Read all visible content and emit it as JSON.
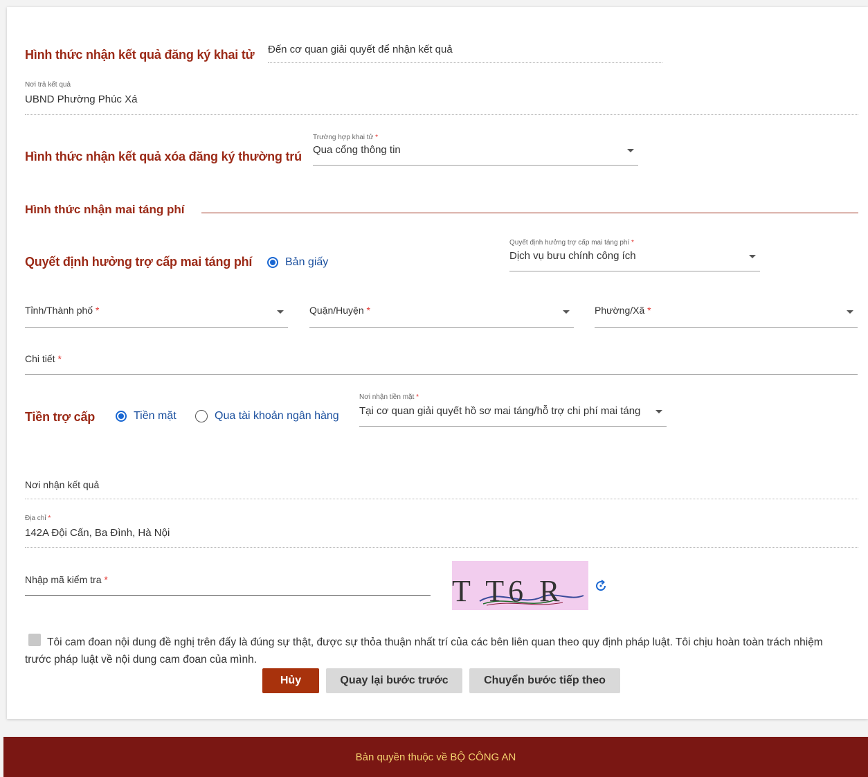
{
  "sections": {
    "death_result": {
      "title": "Hình thức nhận kết quả đăng ký khai tử",
      "value": "Đến cơ quan giải quyết để nhận kết quả"
    },
    "return_place": {
      "label": "Nơi trả kết quả",
      "value": "UBND Phường Phúc Xá"
    },
    "residence_removal": {
      "title": "Hình thức nhận kết quả xóa đăng ký thường trú",
      "select_label": "Trường hợp khai tử",
      "select_value": "Qua cổng thông tin"
    },
    "funeral_fee": {
      "title": "Hình thức nhận mai táng phí"
    },
    "decision": {
      "title": "Quyết định hưởng trợ cấp mai táng phí",
      "radio_label": "Bản giấy",
      "select_label": "Quyết định hưởng trợ cấp mai táng phí",
      "select_value": "Dịch vụ bưu chính công ích"
    },
    "address": {
      "province_label": "Tỉnh/Thành phố",
      "district_label": "Quận/Huyện",
      "ward_label": "Phường/Xã",
      "detail_label": "Chi tiết"
    },
    "allowance": {
      "title": "Tiền trợ cấp",
      "option_cash": "Tiền mặt",
      "option_bank": "Qua tài khoản ngân hàng",
      "select_label": "Nơi nhận tiền mặt",
      "select_value": "Tại cơ quan giải quyết hồ sơ mai táng/hỗ trợ chi phí mai táng"
    },
    "receive": {
      "label": "Nơi nhận kết quả",
      "address_label": "Địa chỉ",
      "address_value": "142A Đội Cấn, Ba Đình, Hà Nội"
    },
    "captcha": {
      "label": "Nhập mã kiểm tra",
      "text": "T T6 R"
    },
    "commitment": "Tôi cam đoan nội dung đề nghị trên đấy là đúng sự thật, được sự thỏa thuận nhất trí của các bên liên quan theo quy định pháp luật. Tôi chịu hoàn toàn trách nhiệm trước pháp luật về nội dung cam đoan của mình."
  },
  "required_mark": "*",
  "buttons": {
    "cancel": "Hủy",
    "back": "Quay lại bước trước",
    "next": "Chuyển bước tiếp theo"
  },
  "footer": "Bản quyền thuộc về BỘ CÔNG AN",
  "icons": {
    "refresh": "refresh-icon",
    "dropdown": "caret-down-icon"
  },
  "colors": {
    "section_title": "#9b2a17",
    "cancel_button": "#a8320c",
    "secondary_button": "#d9d9d9",
    "footer_bg": "#7a1713",
    "footer_text": "#f3d06e",
    "radio": "#1967d2",
    "required": "#e3342f"
  }
}
